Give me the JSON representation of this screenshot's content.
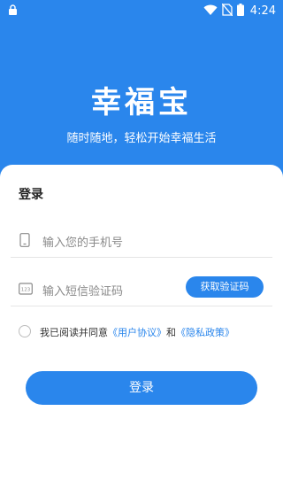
{
  "status_bar": {
    "time": "4:24",
    "icons": [
      "lock-icon",
      "wifi-icon",
      "no-sim-icon",
      "battery-icon"
    ]
  },
  "header": {
    "app_name": "幸福宝",
    "slogan": "随时随地，轻松开始幸福生活"
  },
  "form": {
    "heading": "登录",
    "phone_placeholder": "输入您的手机号",
    "code_placeholder": "输入短信验证码",
    "get_code_label": "获取验证码",
    "agreement": {
      "prefix": "我已阅读并同意",
      "user_agreement": "《用户协议》",
      "conjunction": "和",
      "privacy_policy": "《隐私政策》"
    },
    "login_label": "登录"
  },
  "colors": {
    "primary": "#2a86ec",
    "background": "#ffffff"
  }
}
